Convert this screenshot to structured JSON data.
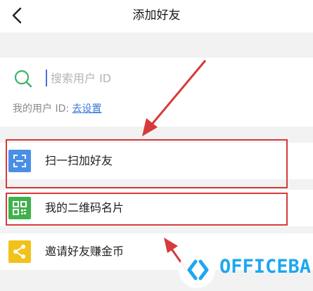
{
  "header": {
    "title": "添加好友"
  },
  "search": {
    "placeholder": "搜索用户 ID"
  },
  "uid": {
    "label": "我的用户 ID:",
    "link": "去设置"
  },
  "items": [
    {
      "label": "扫一扫加好友",
      "icon": "scan-icon",
      "icon_color": "#4a8fe6"
    },
    {
      "label": "我的二维码名片",
      "icon": "qr-code-icon",
      "icon_color": "#3fb24a"
    },
    {
      "label": "邀请好友赚金币",
      "icon": "share-icon",
      "icon_color": "#f2c21a"
    }
  ],
  "highlight_color": "#d63a3a",
  "watermark": {
    "text": "OFFICEBA"
  }
}
